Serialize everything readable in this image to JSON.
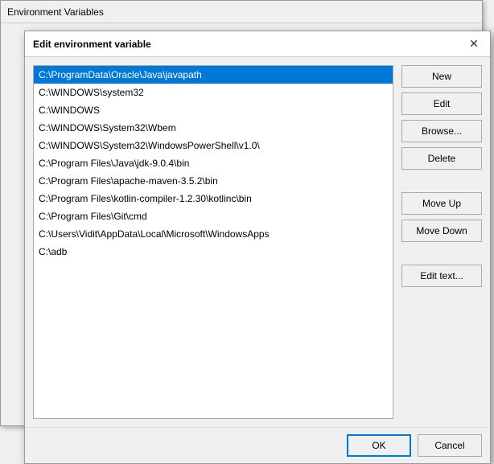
{
  "outerWindow": {
    "title": "Environment Variables"
  },
  "dialog": {
    "title": "Edit environment variable",
    "closeLabel": "✕",
    "paths": [
      {
        "id": 0,
        "value": "C:\\ProgramData\\Oracle\\Java\\javapath",
        "selected": true
      },
      {
        "id": 1,
        "value": "C:\\WINDOWS\\system32",
        "selected": false
      },
      {
        "id": 2,
        "value": "C:\\WINDOWS",
        "selected": false
      },
      {
        "id": 3,
        "value": "C:\\WINDOWS\\System32\\Wbem",
        "selected": false
      },
      {
        "id": 4,
        "value": "C:\\WINDOWS\\System32\\WindowsPowerShell\\v1.0\\",
        "selected": false
      },
      {
        "id": 5,
        "value": "C:\\Program Files\\Java\\jdk-9.0.4\\bin",
        "selected": false
      },
      {
        "id": 6,
        "value": "C:\\Program Files\\apache-maven-3.5.2\\bin",
        "selected": false
      },
      {
        "id": 7,
        "value": "C:\\Program Files\\kotlin-compiler-1.2.30\\kotlinc\\bin",
        "selected": false
      },
      {
        "id": 8,
        "value": "C:\\Program Files\\Git\\cmd",
        "selected": false
      },
      {
        "id": 9,
        "value": "C:\\Users\\Vidit\\AppData\\Local\\Microsoft\\WindowsApps",
        "selected": false
      },
      {
        "id": 10,
        "value": "C:\\adb",
        "selected": false
      }
    ],
    "buttons": {
      "new": "New",
      "edit": "Edit",
      "browse": "Browse...",
      "delete": "Delete",
      "moveUp": "Move Up",
      "moveDown": "Move Down",
      "editText": "Edit text..."
    },
    "footer": {
      "ok": "OK",
      "cancel": "Cancel"
    }
  }
}
